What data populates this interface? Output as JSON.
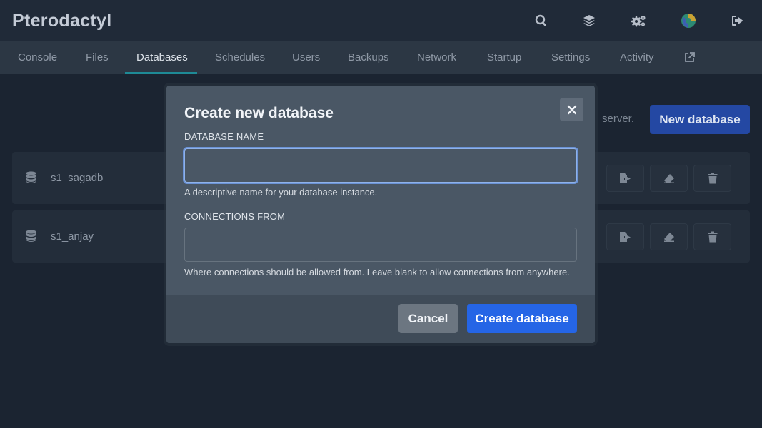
{
  "app": {
    "brand": "Pterodactyl"
  },
  "top_icons": [
    "search-icon",
    "layers-icon",
    "cogs-icon",
    "avatar",
    "sign-out-icon"
  ],
  "nav": {
    "tabs": [
      {
        "label": "Console"
      },
      {
        "label": "Files"
      },
      {
        "label": "Databases",
        "active": true
      },
      {
        "label": "Schedules"
      },
      {
        "label": "Users"
      },
      {
        "label": "Backups"
      },
      {
        "label": "Network"
      },
      {
        "label": "Startup"
      },
      {
        "label": "Settings"
      },
      {
        "label": "Activity"
      }
    ],
    "external_icon": "external-link-icon"
  },
  "page": {
    "visible_text_fragment": "server.",
    "new_database_label": "New database",
    "databases": [
      {
        "name": "s1_sagadb"
      },
      {
        "name": "s1_anjay"
      }
    ],
    "row_action_icons": [
      "file-export-icon",
      "eraser-icon",
      "trash-icon"
    ]
  },
  "modal": {
    "title": "Create new database",
    "fields": {
      "database_name": {
        "label": "DATABASE NAME",
        "value": "",
        "help": "A descriptive name for your database instance."
      },
      "connections_from": {
        "label": "CONNECTIONS FROM",
        "value": "",
        "help": "Where connections should be allowed from. Leave blank to allow connections from anywhere."
      }
    },
    "cancel_label": "Cancel",
    "submit_label": "Create database"
  },
  "colors": {
    "background": "#1b2431",
    "accent_primary": "#2565e6",
    "tab_underline": "#1e8a96",
    "modal_bg": "#4a5765"
  }
}
